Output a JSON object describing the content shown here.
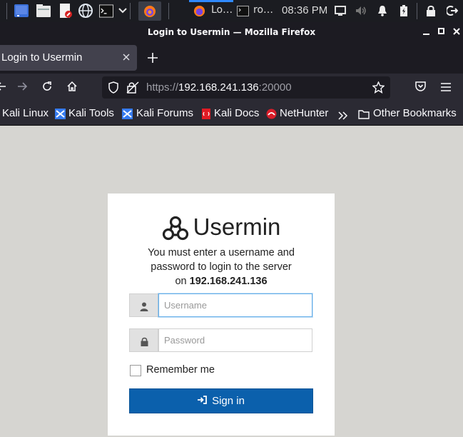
{
  "taskbar": {
    "tasks": [
      {
        "label": "Lo…",
        "icon": "firefox-icon"
      },
      {
        "label": "ro…",
        "icon": "terminal-icon"
      }
    ],
    "clock": "08:36 PM"
  },
  "window": {
    "title": "Login to Usermin — Mozilla Firefox"
  },
  "tabs": [
    {
      "label": "Login to Usermin",
      "active": true
    }
  ],
  "address_bar": {
    "scheme": "https://",
    "host": "192.168.241.136",
    "port": ":20000"
  },
  "bookmarks": [
    {
      "label": "Kali Linux"
    },
    {
      "label": "Kali Tools"
    },
    {
      "label": "Kali Forums"
    },
    {
      "label": "Kali Docs"
    },
    {
      "label": "NetHunter"
    }
  ],
  "other_bookmarks": "Other Bookmarks",
  "login": {
    "brand": "Usermin",
    "message_line1": "You must enter a username and",
    "message_line2": "password to login to the server",
    "message_prefix": "on",
    "server": "192.168.241.136",
    "username_placeholder": "Username",
    "password_placeholder": "Password",
    "remember_label": "Remember me",
    "signin_label": "Sign in"
  },
  "colors": {
    "accent": "#0b60ac",
    "page_background": "#d6d5d1",
    "browser_chrome": "#2b2a33"
  }
}
